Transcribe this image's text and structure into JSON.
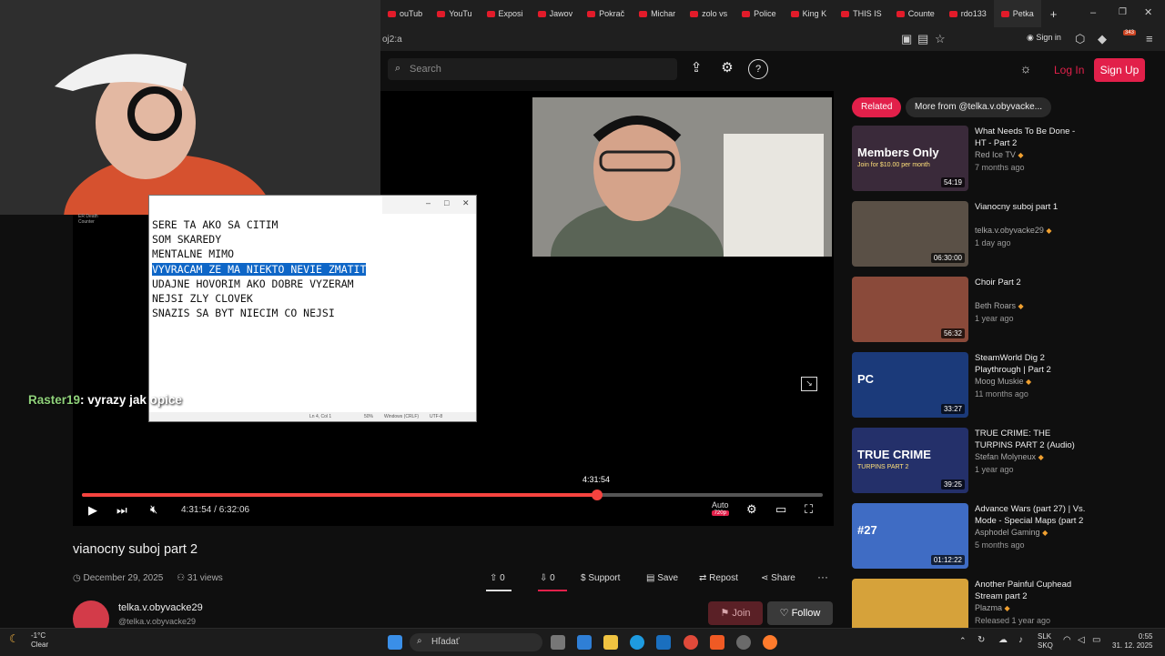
{
  "browser": {
    "tabs": [
      "ouTub",
      "YouTu",
      "Exposi",
      "Jawov",
      "Pokrač",
      "Michar",
      "zolo vs",
      "Police",
      "King K",
      "THIS IS",
      "Counte",
      "rdo133",
      "Petka"
    ],
    "url": "oj2:a",
    "sign_in": "Sign in",
    "badge": "343"
  },
  "header": {
    "search_placeholder": "Search",
    "login": "Log In",
    "signup": "Sign Up"
  },
  "stream": {
    "notepad_lines": [
      "SERE TA AKO SA CITIM",
      "SOM SKAREDY",
      "MENTALNE MIMO",
      "VYVRACAM ZE MA NIEKTO NEVIE ZMATIT",
      "UDAJNE HOVORIM AKO DOBRE VYZERAM",
      "NEJSI ZLY CLOVEK",
      "SNAZIS SA BYT NIECIM CO NEJSI"
    ],
    "status": {
      "pos": "Ln 4, Col 1",
      "zoom": "50%",
      "eol": "Windows (CRLF)",
      "enc": "UTF-8"
    },
    "counter": "ER Death Counter",
    "chat_user": "Raster19",
    "chat_text": ": vyrazy jak opice"
  },
  "player": {
    "current": "4:31:54",
    "sep": "/",
    "total": "6:32:06",
    "tooltip": "4:31:54",
    "progress": 0.695,
    "quality": "Auto",
    "hd": "720p"
  },
  "video": {
    "title": "vianocny suboj part 2",
    "date": "December 29, 2025",
    "views": "31 views",
    "upvotes": "0",
    "downvotes": "0",
    "support": "Support",
    "save": "Save",
    "repost": "Repost",
    "share": "Share",
    "channel_name": "telka.v.obyvacke29",
    "channel_handle": "@telka.v.obyvacke29",
    "join": "Join",
    "follow": "Follow"
  },
  "sidebar": {
    "tab_related": "Related",
    "tab_more": "More from @telka.v.obyvacke...",
    "items": [
      {
        "title": "What Needs To Be Done - HT - Part 2",
        "channel": "Red Ice TV",
        "age": "7 months ago",
        "duration": "54:19",
        "thumb_text": "Members Only",
        "thumb_sub": "Join for $10.00 per month",
        "color": "#3a2a3a"
      },
      {
        "title": "Vianocny suboj part 1",
        "channel": "telka.v.obyvacke29",
        "age": "1 day ago",
        "duration": "06:30:00",
        "thumb_text": "",
        "thumb_sub": "",
        "color": "#5a5046"
      },
      {
        "title": "Choir Part 2",
        "channel": "Beth Roars",
        "age": "1 year ago",
        "duration": "56:32",
        "thumb_text": "",
        "thumb_sub": "",
        "color": "#8a4a3a"
      },
      {
        "title": "SteamWorld Dig 2 Playthrough | Part 2",
        "channel": "Moog Muskie",
        "age": "11 months ago",
        "duration": "33:27",
        "thumb_text": "PC",
        "thumb_sub": "",
        "color": "#1b3a7a"
      },
      {
        "title": "TRUE CRIME: THE TURPINS PART 2 (Audio)",
        "channel": "Stefan Molyneux",
        "age": "1 year ago",
        "duration": "39:25",
        "thumb_text": "TRUE CRIME",
        "thumb_sub": "TURPINS PART 2",
        "color": "#24306a"
      },
      {
        "title": "Advance Wars (part 27) | Vs. Mode - Special Maps (part 2",
        "channel": "Asphodel Gaming",
        "age": "5 months ago",
        "duration": "01:12:22",
        "thumb_text": "#27",
        "thumb_sub": "",
        "color": "#3f6cc4"
      },
      {
        "title": "Another Painful Cuphead Stream part 2",
        "channel": "Plazma",
        "age": "Released 1 year ago",
        "duration": "",
        "thumb_text": "",
        "thumb_sub": "",
        "color": "#d6a23a"
      }
    ]
  },
  "taskbar": {
    "temp": "-1°C",
    "cond": "Clear",
    "search": "Hľadať",
    "lang1": "SLK",
    "lang2": "SKQ",
    "time": "0:55",
    "date": "31. 12. 2025"
  }
}
